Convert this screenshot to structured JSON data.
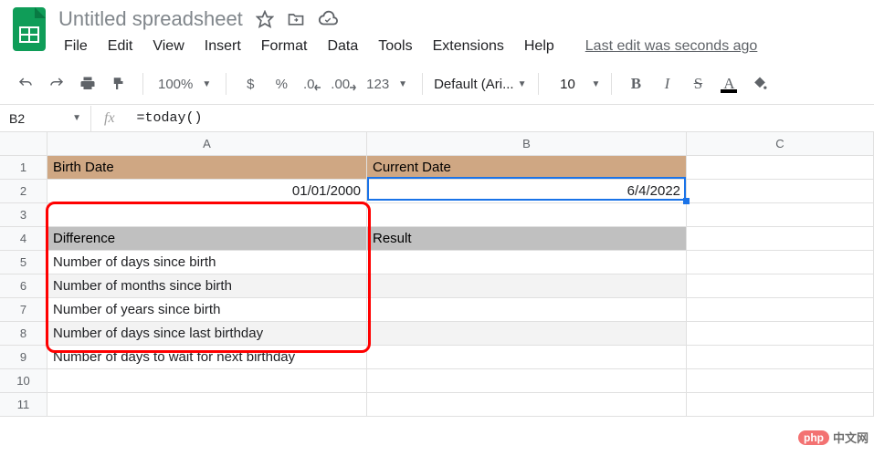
{
  "header": {
    "title": "Untitled spreadsheet",
    "menus": [
      "File",
      "Edit",
      "View",
      "Insert",
      "Format",
      "Data",
      "Tools",
      "Extensions",
      "Help"
    ],
    "last_edit": "Last edit was seconds ago"
  },
  "toolbar": {
    "zoom": "100%",
    "currency": "$",
    "percent": "%",
    "dec_dec": ".0",
    "inc_dec": ".00",
    "num_fmt": "123",
    "font": "Default (Ari...",
    "font_size": "10",
    "bold": "B",
    "italic": "I",
    "strike": "S",
    "text_color": "A"
  },
  "fx": {
    "namebox": "B2",
    "fx_label": "fx",
    "formula": "=today()"
  },
  "grid": {
    "cols": [
      "A",
      "B",
      "C"
    ],
    "rowcount": 11,
    "cells": {
      "A1": "Birth Date",
      "B1": "Current Date",
      "A2": "01/01/2000",
      "B2": "6/4/2022",
      "A4": "Difference",
      "B4": "Result",
      "A5": "Number of days since birth",
      "A6": "Number of months since birth",
      "A7": "Number of years since birth",
      "A8": "Number of days since last birthday",
      "A9": "Number of days to wait for next birthday"
    }
  },
  "watermark": {
    "pill": "php",
    "text": "中文网"
  }
}
